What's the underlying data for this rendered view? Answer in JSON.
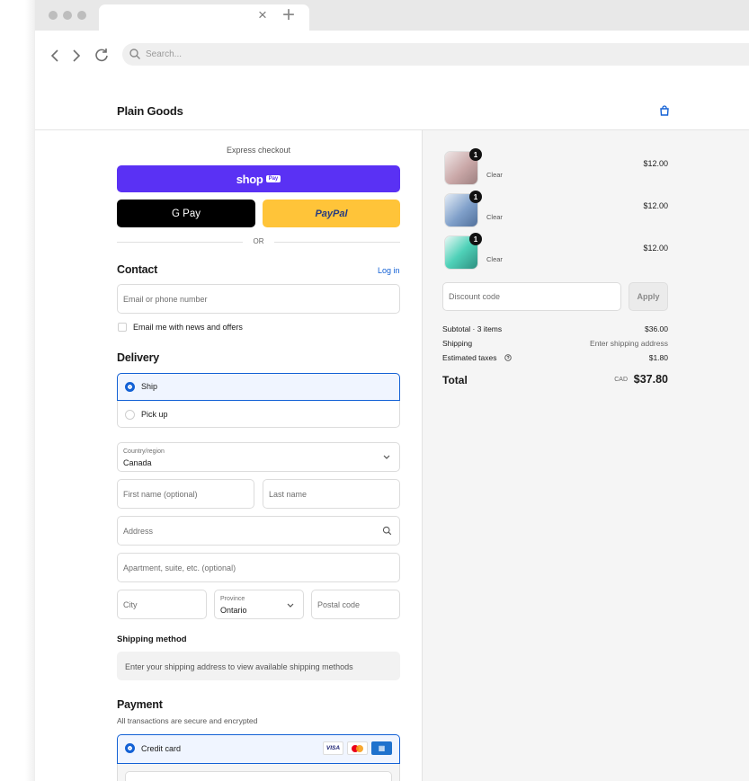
{
  "browser": {
    "search_placeholder": "Search..."
  },
  "store": {
    "name": "Plain Goods"
  },
  "checkout": {
    "express_label": "Express checkout",
    "shop_pay_label": "shop",
    "shop_pay_badge": "Pay",
    "gpay_label": "G Pay",
    "paypal_label": "PayPal",
    "or_label": "OR",
    "contact": {
      "heading": "Contact",
      "login_link": "Log in",
      "email_placeholder": "Email or phone number",
      "newsletter_label": "Email me with news and offers"
    },
    "delivery": {
      "heading": "Delivery",
      "options": [
        {
          "label": "Ship",
          "selected": true
        },
        {
          "label": "Pick up",
          "selected": false
        }
      ],
      "country_label": "Country/region",
      "country_value": "Canada",
      "first_name_placeholder": "First name (optional)",
      "last_name_placeholder": "Last name",
      "address_placeholder": "Address",
      "apartment_placeholder": "Apartment, suite, etc. (optional)",
      "city_placeholder": "City",
      "province_label": "Province",
      "province_value": "Ontario",
      "postal_placeholder": "Postal code"
    },
    "shipping_method": {
      "heading": "Shipping method",
      "message": "Enter your shipping address to view available shipping methods"
    },
    "payment": {
      "heading": "Payment",
      "subtitle": "All transactions are secure and encrypted",
      "method_label": "Credit card",
      "card_brands": [
        "VISA",
        "mastercard",
        "amex"
      ]
    }
  },
  "summary": {
    "items": [
      {
        "name": "Clear",
        "quantity": "1",
        "price": "$12.00",
        "color": "#c9a7a7"
      },
      {
        "name": "Clear",
        "quantity": "1",
        "price": "$12.00",
        "color": "#7f9fc9"
      },
      {
        "name": "Clear",
        "quantity": "1",
        "price": "$12.00",
        "color": "#4fd1b8"
      }
    ],
    "discount_placeholder": "Discount code",
    "apply_label": "Apply",
    "subtotal_label": "Subtotal · 3 items",
    "subtotal_value": "$36.00",
    "shipping_label": "Shipping",
    "shipping_value": "Enter shipping address",
    "taxes_label": "Estimated taxes",
    "taxes_value": "$1.80",
    "total_label": "Total",
    "total_currency": "CAD",
    "total_value": "$37.80"
  },
  "colors": {
    "shop_pay": "#5a31f4",
    "paypal": "#ffc439",
    "accent": "#1361d5"
  }
}
